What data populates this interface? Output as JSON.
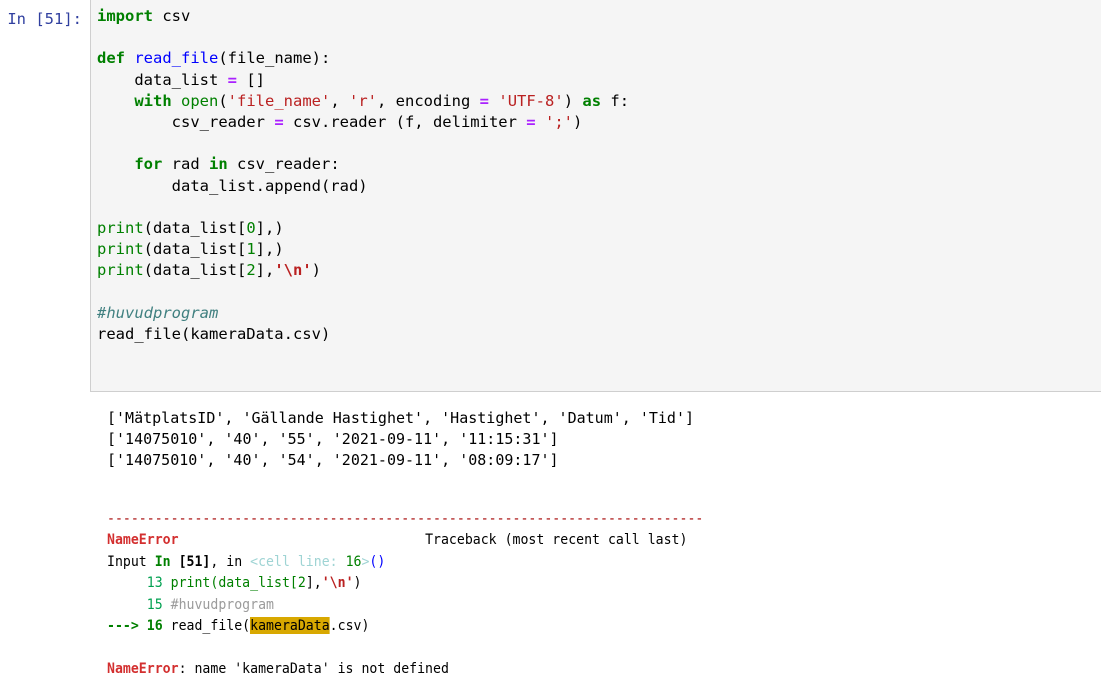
{
  "cell": {
    "prompt_label": "In [51]:",
    "prompt_color": "#303f9f",
    "background": "#f5f5f5",
    "code_lines": [
      "import csv",
      "",
      "def read_file(file_name):",
      "    data_list = []",
      "    with open('file_name', 'r', encoding = 'UTF-8') as f:",
      "        csv_reader = csv.reader (f, delimiter = ';')",
      "",
      "    for rad in csv_reader:",
      "        data_list.append(rad)",
      "",
      "print(data_list[0],)",
      "print(data_list[1],)",
      "print(data_list[2],'\\n')",
      "",
      "#huvudprogram",
      "read_file(kameraData.csv)"
    ],
    "tokens": {
      "import": "import",
      "csv_module": "csv",
      "def": "def",
      "func_name": "read_file",
      "func_arg": "(file_name):",
      "data_list_assign": "    data_list ",
      "equals": "=",
      "empty_list": " []",
      "with": "with",
      "open": "open",
      "file_name_str": "'file_name'",
      "mode_str": "'r'",
      "encoding_kw": " encoding ",
      "utf8_str": "'UTF-8'",
      "as": "as",
      "f_colon": " f:",
      "csv_reader_assign": "        csv_reader ",
      "csv_reader_call": " csv.reader (f, delimiter ",
      "semicolon_str": "';'",
      "for": "for",
      "rad": " rad ",
      "in": "in",
      "csv_reader_iter": " csv_reader:",
      "append_line": "        data_list.append(rad)",
      "print": "print",
      "print0": "(data_list[",
      "idx0": "0",
      "idx1": "1",
      "idx2": "2",
      "close0": "],)",
      "close2": "],",
      "newline_str": "'\\n'",
      "close_paren": ")",
      "comment": "#huvudprogram",
      "call_line": "read_file(kameraData.csv)"
    }
  },
  "output": {
    "lines": [
      "['MätplatsID', 'Gällande Hastighet', 'Hastighet', 'Datum', 'Tid']",
      "['14075010', '40', '55', '2021-09-11', '11:15:31']",
      "['14075010', '40', '54', '2021-09-11', '08:09:17']"
    ]
  },
  "traceback": {
    "separator": "---------------------------------------------------------------------------",
    "error_type": "NameError",
    "traceback_header": "Traceback (most recent call last)",
    "input_prefix": "Input ",
    "input_in": "In",
    "input_cell_id": " [51]",
    "input_comma_in": ", in ",
    "cell_line_open": "<cell line: ",
    "cell_line_num": "16",
    "cell_line_close": ">",
    "cell_line_parens": "()",
    "frames": [
      {
        "marker": "     ",
        "lineno": "13",
        "code_prefix": " print(data_list[",
        "code_idx": "2",
        "code_mid": "],",
        "code_str": "'\\n'",
        "code_suffix": ")"
      },
      {
        "marker": "     ",
        "lineno": "15",
        "comment": " #huvudprogram"
      },
      {
        "marker": "---> ",
        "lineno": "16",
        "code_pre": " read_file(",
        "highlight": "kameraData",
        "code_post": ".csv)"
      }
    ],
    "final_error_name": "NameError",
    "final_error_message": ": name 'kameraData' is not defined",
    "highlight_color": "#d8a800",
    "error_color": "#d32f2f",
    "separator_color": "#a40000"
  }
}
